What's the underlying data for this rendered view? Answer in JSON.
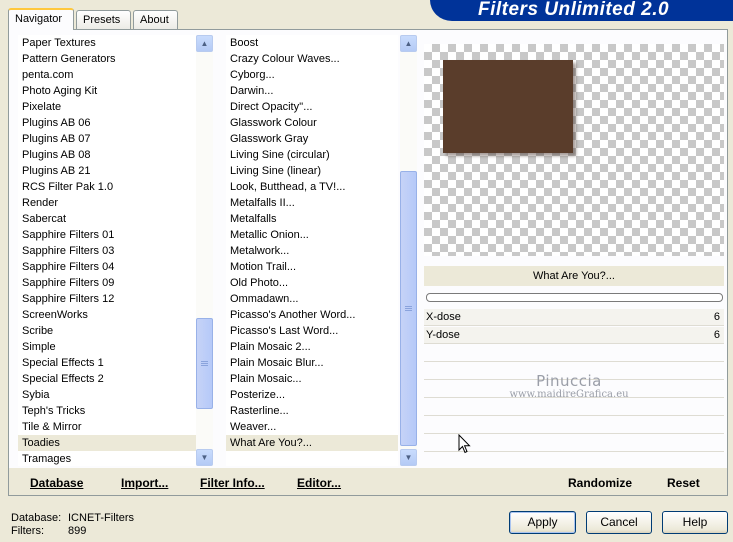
{
  "tabs": [
    {
      "label": "Navigator",
      "active": true
    },
    {
      "label": "Presets",
      "active": false
    },
    {
      "label": "About",
      "active": false
    }
  ],
  "banner": {
    "title": "Filters Unlimited 2.0"
  },
  "categories": {
    "items": [
      "Paper Textures",
      "Pattern Generators",
      "penta.com",
      "Photo Aging Kit",
      "Pixelate",
      "Plugins AB 06",
      "Plugins AB 07",
      "Plugins AB 08",
      "Plugins AB 21",
      "RCS Filter Pak 1.0",
      "Render",
      "Sabercat",
      "Sapphire Filters 01",
      "Sapphire Filters 03",
      "Sapphire Filters 04",
      "Sapphire Filters 09",
      "Sapphire Filters 12",
      "ScreenWorks",
      "Scribe",
      "Simple",
      "Special Effects 1",
      "Special Effects 2",
      "Sybia",
      "Teph's Tricks",
      "Tile & Mirror",
      "Toadies",
      "Tramages"
    ],
    "selected_index": 25
  },
  "filters": {
    "items": [
      "Boost",
      "Crazy Colour Waves...",
      "Cyborg...",
      "Darwin...",
      "Direct Opacity''...",
      "Glasswork Colour",
      "Glasswork Gray",
      "Living Sine (circular)",
      "Living Sine (linear)",
      "Look, Butthead, a TV!...",
      "Metalfalls II...",
      "Metalfalls",
      "Metallic Onion...",
      "Metalwork...",
      "Motion Trail...",
      "Old Photo...",
      "Ommadawn...",
      "Picasso's Another Word...",
      "Picasso's Last Word...",
      "Plain Mosaic 2...",
      "Plain Mosaic Blur...",
      "Plain Mosaic...",
      "Posterize...",
      "Rasterline...",
      "Weaver...",
      "What Are You?..."
    ],
    "selected_index": 25
  },
  "preview": {
    "shape_color": "#5a3d2b"
  },
  "filter_name": "What Are You?...",
  "controls": [
    {
      "label": "X-dose",
      "value": "6"
    },
    {
      "label": "Y-dose",
      "value": "6"
    }
  ],
  "watermark": {
    "name": "Pinuccia",
    "url": "www.maidireGrafica.eu"
  },
  "bottom_links": {
    "database": "Database",
    "import": "Import...",
    "filter_info": "Filter Info...",
    "editor": "Editor...",
    "randomize": "Randomize",
    "reset": "Reset"
  },
  "status": {
    "database_label": "Database:",
    "database_value": "ICNET-Filters",
    "filters_label": "Filters:",
    "filters_value": "899"
  },
  "buttons": {
    "apply": "Apply",
    "cancel": "Cancel",
    "help": "Help"
  }
}
